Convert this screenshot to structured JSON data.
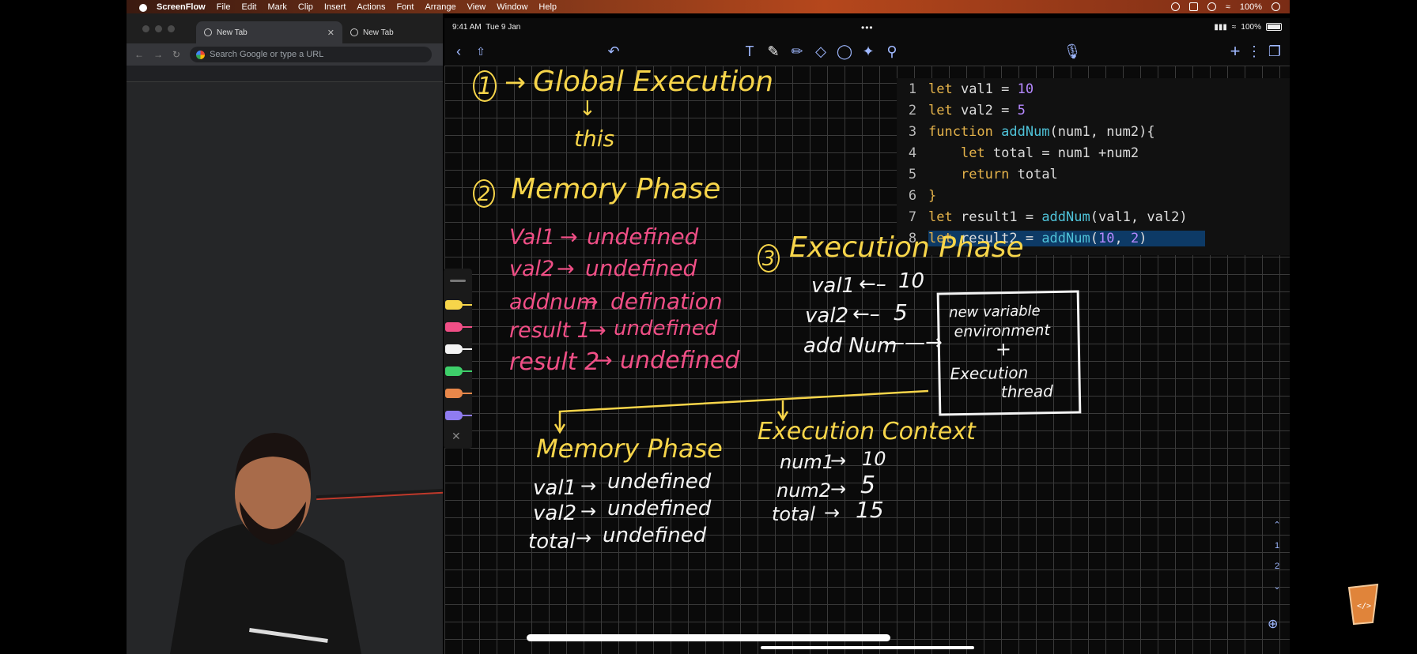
{
  "menubar": {
    "app_name": "ScreenFlow",
    "items": [
      "File",
      "Edit",
      "Mark",
      "Clip",
      "Insert",
      "Actions",
      "Font",
      "Arrange",
      "View",
      "Window",
      "Help"
    ],
    "battery": "100%"
  },
  "browser": {
    "tabs": [
      {
        "label": "New Tab"
      },
      {
        "label": "New Tab"
      }
    ],
    "omnibox_placeholder": "Search Google or type a URL"
  },
  "ipad": {
    "time": "9:41 AM",
    "date": "Tue 9 Jan",
    "battery": "100%",
    "icons": [
      "back-icon",
      "share-icon",
      "undo-icon",
      "text-tool-icon",
      "pen-icon",
      "highlighter-icon",
      "eraser-icon",
      "lasso-icon",
      "shapes-icon",
      "pointer-icon",
      "microphone-icon",
      "add-icon",
      "more-icon",
      "pages-icon"
    ]
  },
  "code": {
    "lines": [
      {
        "num": "1",
        "kw": "let",
        "rest": " val1 = ",
        "num_val": "10",
        "tail": ""
      },
      {
        "num": "2",
        "kw": "let",
        "rest": " val2 = ",
        "num_val": "5",
        "tail": ""
      },
      {
        "num": "3",
        "kw": "function",
        "fn": " addNum",
        "rest": "(num1, num2){"
      },
      {
        "num": "4",
        "indent": "    ",
        "kw": "let",
        "rest": " total = num1 +num2"
      },
      {
        "num": "5",
        "indent": "    ",
        "kw": "return",
        "rest": " total"
      },
      {
        "num": "6",
        "rest": "}"
      },
      {
        "num": "7",
        "kw": "let",
        "rest": " result1 = ",
        "fn": "addNum",
        "tail": "(val1, val2)"
      },
      {
        "num": "8",
        "kw": "let",
        "rest": " result2 = ",
        "fn": "addNum",
        "tail_a": "(",
        "arg1": "10",
        "sep": ", ",
        "arg2": "2",
        "tail_b": ")"
      }
    ]
  },
  "notes": {
    "step1_num": "1",
    "step1_title": "Global Execution",
    "step1_sub": "this",
    "step2_num": "2",
    "step2_title": "Memory Phase",
    "memory": [
      {
        "name": "Val1",
        "value": "undefined"
      },
      {
        "name": "val2",
        "value": "undefined"
      },
      {
        "name": "addnum",
        "value": "defination"
      },
      {
        "name": "result 1",
        "value": "undefined"
      },
      {
        "name": "result 2",
        "value": "undefined"
      }
    ],
    "step3_num": "3",
    "step3_title": "Execution Phase",
    "exec": [
      {
        "name": "val1",
        "value": "10"
      },
      {
        "name": "val2",
        "value": "5"
      },
      {
        "name": "add Num",
        "value": ""
      }
    ],
    "box_lines": [
      "new variable",
      "environment",
      "+",
      "Execution",
      "thread"
    ],
    "memory2_title": "Memory Phase",
    "memory2": [
      {
        "name": "val1",
        "value": "undefined"
      },
      {
        "name": "val2",
        "value": "undefined"
      },
      {
        "name": "total",
        "value": "undefined"
      }
    ],
    "context_title": "Execution Context",
    "context": [
      {
        "name": "num1",
        "value": "10"
      },
      {
        "name": "num2",
        "value": "5"
      },
      {
        "name": "total",
        "value": "15"
      }
    ]
  },
  "page_nav": {
    "pages": [
      "1",
      "2"
    ]
  },
  "colors": {
    "yellow": "#f7d54a",
    "pink": "#f04f86",
    "white": "#f4f4f4",
    "code_highlight": "#0d3a66"
  }
}
